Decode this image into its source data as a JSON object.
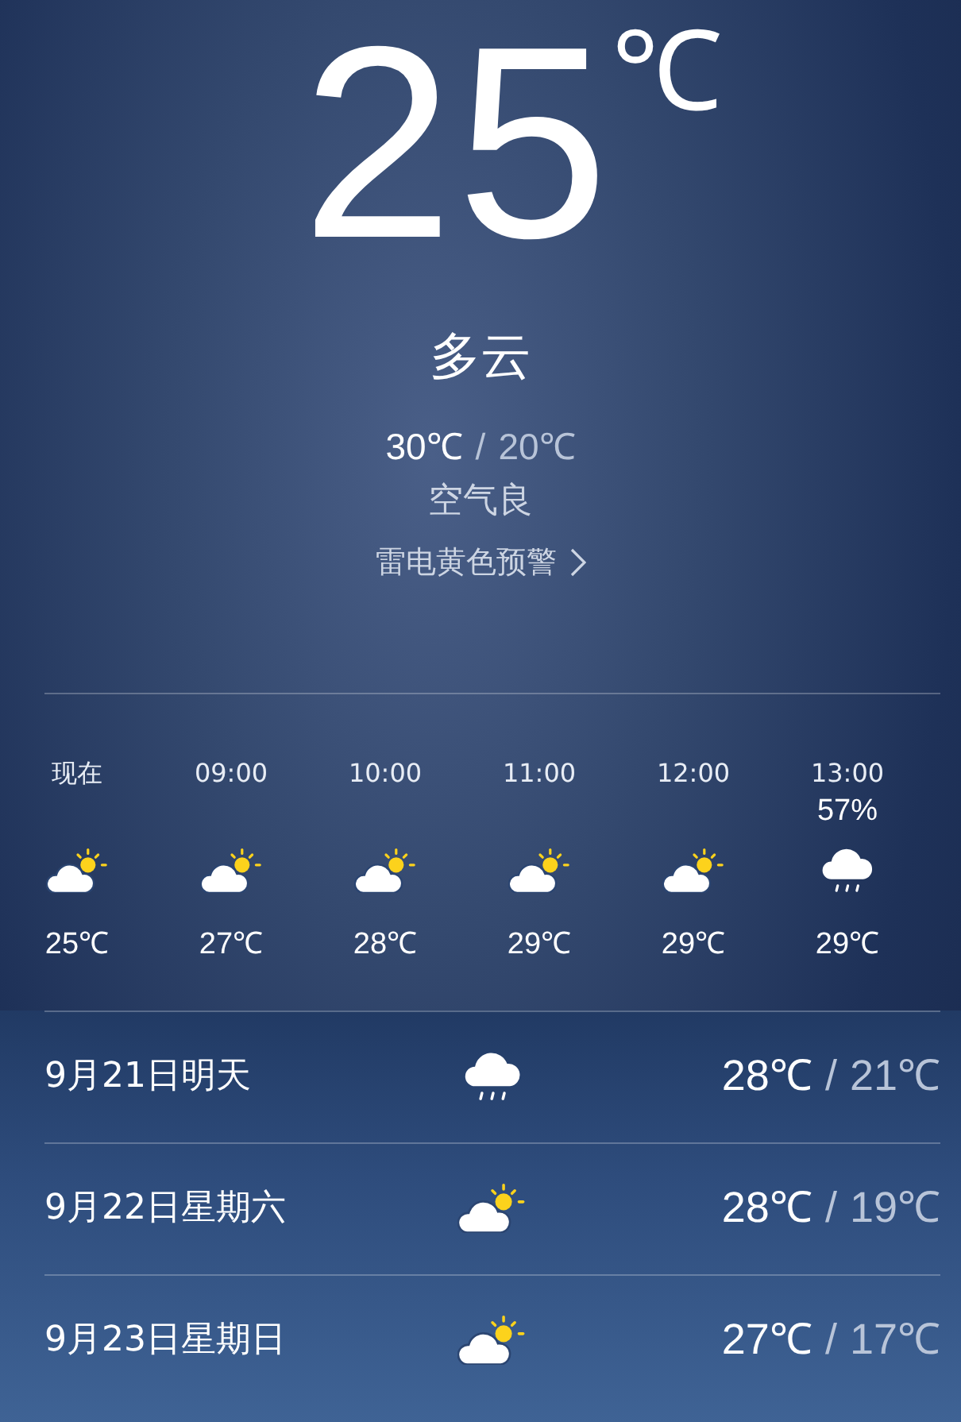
{
  "current": {
    "temperature": "25",
    "unit": "℃",
    "condition": "多云",
    "high": "30℃",
    "separator": "/",
    "low": "20℃",
    "air_quality": "空气良",
    "alert": "雷电黄色预警"
  },
  "hourly": [
    {
      "time": "现在",
      "kind": "partly-cloudy",
      "temperature": "25℃"
    },
    {
      "time": "09:00",
      "kind": "partly-cloudy",
      "temperature": "27℃"
    },
    {
      "time": "10:00",
      "kind": "partly-cloudy",
      "temperature": "28℃"
    },
    {
      "time": "11:00",
      "kind": "partly-cloudy",
      "temperature": "29℃"
    },
    {
      "time": "12:00",
      "kind": "partly-cloudy",
      "temperature": "29℃"
    },
    {
      "time": "13:00",
      "precipitation": "57%",
      "kind": "rain",
      "temperature": "29℃"
    }
  ],
  "daily": [
    {
      "date": "9月21日明天",
      "kind": "rain",
      "high": "28℃",
      "separator": "/",
      "low": "21℃"
    },
    {
      "date": "9月22日星期六",
      "kind": "partly-cloudy",
      "high": "28℃",
      "separator": "/",
      "low": "19℃"
    },
    {
      "date": "9月23日星期日",
      "kind": "partly-cloudy",
      "high": "27℃",
      "separator": "/",
      "low": "17℃"
    }
  ]
}
